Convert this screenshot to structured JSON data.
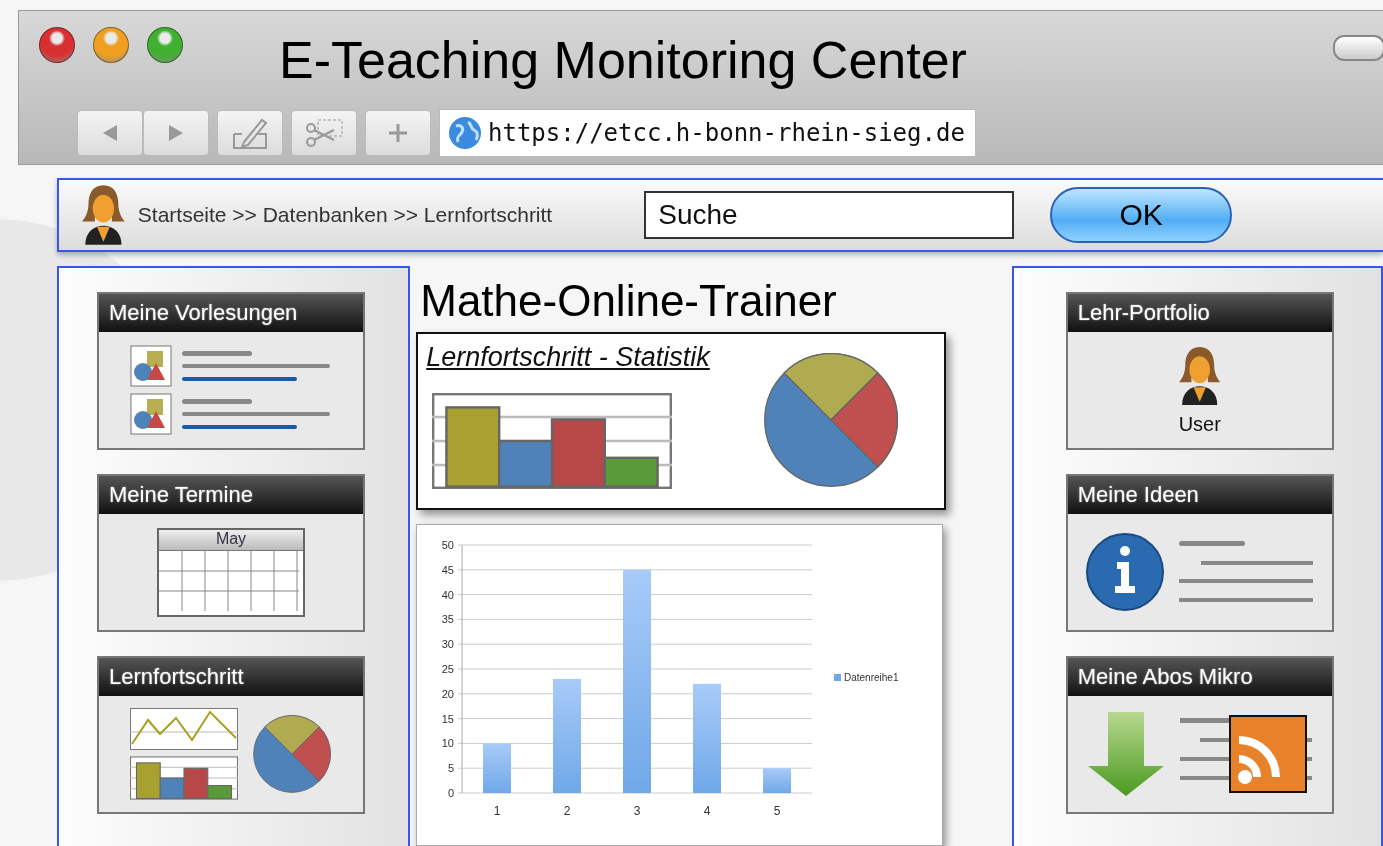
{
  "window": {
    "title": "E-Teaching Monitoring Center",
    "url": "https://etcc.h-bonn-rhein-sieg.de"
  },
  "breadcrumb": "Startseite >> Datenbanken >> Lernfortschritt",
  "search": {
    "value": "Suche"
  },
  "ok_button": "OK",
  "left_widgets": [
    {
      "kind": "lectures",
      "title": "Meine Vorlesungen"
    },
    {
      "kind": "calendar",
      "title": "Meine Termine",
      "month": "May"
    },
    {
      "kind": "progress",
      "title": "Lernfortschritt"
    }
  ],
  "main": {
    "title": "Mathe-Online-Trainer",
    "stat_card": {
      "title": "Lernfortschritt - Statistik"
    },
    "chart_data": {
      "type": "bar",
      "grid": true,
      "categories": [
        "1",
        "2",
        "3",
        "4",
        "5"
      ],
      "series": [
        {
          "name": "Datenreihe1",
          "color": "#6fa8e8",
          "values": [
            10,
            23,
            45,
            22,
            5
          ]
        }
      ],
      "ylim": [
        0,
        50
      ],
      "yticks": [
        0,
        5,
        10,
        15,
        20,
        25,
        30,
        35,
        40,
        45,
        50
      ]
    }
  },
  "right_widgets": [
    {
      "kind": "portfolio",
      "title": "Lehr-Portfolio",
      "caption": "User"
    },
    {
      "kind": "ideas",
      "title": "Meine Ideen"
    },
    {
      "kind": "subscriptions",
      "title": "Meine Abos Mikro"
    }
  ]
}
